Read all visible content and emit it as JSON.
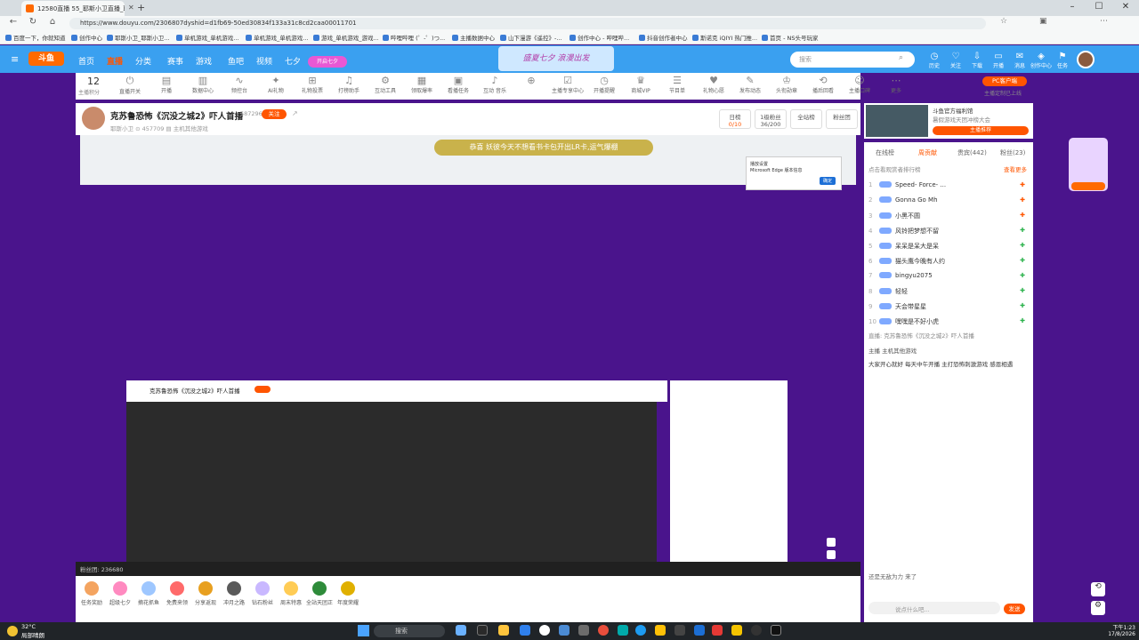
{
  "browser": {
    "tab_title": "12580直播 55_耶斯小卫直播_耶斯",
    "url": "https://www.douyu.com/2306807dyshid=d1fb69-50ed30834f133a31c8cd2caa00011701"
  },
  "bookmarks": [
    "百度一下，你就知道",
    "创作中心",
    "耶斯小卫_耶斯小卫...",
    "单机游戏_单机游戏...",
    "单机游戏_单机游戏...",
    "游戏_单机游戏_游戏...",
    "哔哩哔哩 (゜-゜)つ...",
    "主播数据中心",
    "山下漫游《遥控》-...",
    "创作中心 - 哔哩哔...",
    "抖音创作者中心",
    "斯诺克 iQIYI 热门推...",
    "首页 - NS头号玩家"
  ],
  "nav": {
    "items": [
      "首页",
      "直播",
      "分类",
      "赛事",
      "游戏",
      "鱼吧",
      "视频",
      "七夕"
    ],
    "logo": "斗鱼",
    "active": "直播",
    "promo": "盛夏七夕 浪漫出发",
    "badge": "开启七夕"
  },
  "search": {
    "placeholder": "搜索"
  },
  "user_icons": [
    "历史",
    "关注",
    "下载",
    "开播",
    "消息",
    "创作中心",
    "任务"
  ],
  "tools": {
    "level": "12",
    "level_label": "主播积分",
    "items": [
      "直播开关",
      "开播",
      "数据中心",
      "频控台",
      "AI礼物",
      "礼物投票",
      "打榜助手",
      "互动工具",
      "领取爆率",
      "看播任务",
      "互动 音乐",
      "",
      "主播专享中心",
      "开播提醒",
      "商城VIP",
      "节目单",
      "礼物心愿",
      "发布动态",
      "头衔勋章",
      "播后回看",
      "主播口碑",
      "更多"
    ],
    "pc_button": "PC客户端",
    "hint": "主播定制已上线"
  },
  "stream": {
    "title": "克苏鲁恐怖《沉没之城2》吓人首播",
    "follow_count": "587296",
    "follow_btn": "关注",
    "streamer_name": "耶斯小卫",
    "heat": "457709",
    "category": "主机其他游戏",
    "stat1_label": "日榜",
    "stat1_val": "0/10",
    "stat2_label": "1级粉丝",
    "stat2_val": "36/200",
    "stat3": "全站榜",
    "stat4": "粉丝团"
  },
  "inner": {
    "banner": "恭喜 妖彼今天不想看书卡包开出LR卡,运气爆棚",
    "popup_title": "播放设置",
    "popup_text": "Microsoft Edge 版本信息",
    "popup_btn": "确定",
    "inner_title": "克苏鲁恐怖《沉没之城2》吓人首播",
    "fans": "粉丝团: 236680"
  },
  "gifts": [
    "任务奖励",
    "超级七夕",
    "摘花抓鱼",
    "免费来领",
    "分享返现",
    "冲月之路",
    "钻石粉丝",
    "周末特惠",
    "全站天团正",
    "年度荣耀"
  ],
  "ad": {
    "title": "斗鱼官方福利馆",
    "sub": "暑假游戏天团冲榜大会",
    "btn": "主播推荐"
  },
  "side": {
    "tabs": [
      "在线榜",
      "周贡献",
      "贵宾(442)",
      "粉丝(23)"
    ],
    "active_tab": "周贡献",
    "rank_head": "点击看观赏者排行榜",
    "rank_more": "查看更多",
    "rows": [
      {
        "n": "1",
        "name": "Speed‑ Force‑ ..."
      },
      {
        "n": "2",
        "name": "Gonna Go Mh"
      },
      {
        "n": "3",
        "name": "小黑不圆"
      },
      {
        "n": "4",
        "name": "风铃把梦想不留"
      },
      {
        "n": "5",
        "name": "呆呆是呆大是呆"
      },
      {
        "n": "6",
        "name": "猫头鹰今晚有人约"
      },
      {
        "n": "7",
        "name": "bingyu2075"
      },
      {
        "n": "8",
        "name": "轻轻"
      },
      {
        "n": "9",
        "name": "天会带星星"
      },
      {
        "n": "10",
        "name": "嘿嘿是不好小虎"
      }
    ],
    "sys": "直播: 克苏鲁恐怖《沉没之城2》吓人首播",
    "who": "主播  主机其他游戏",
    "msg": "大家开心就好 每天中午开播 主打恐怖刺激游戏 感恩相遇",
    "enter": "还是无敌为力 来了",
    "input": "说点什么吧...",
    "send": "发送"
  },
  "taskbar": {
    "weather": "32°C",
    "weather2": "局部晴朗",
    "search": "搜索",
    "time": "下午1:23",
    "date": "17/8/2026"
  }
}
